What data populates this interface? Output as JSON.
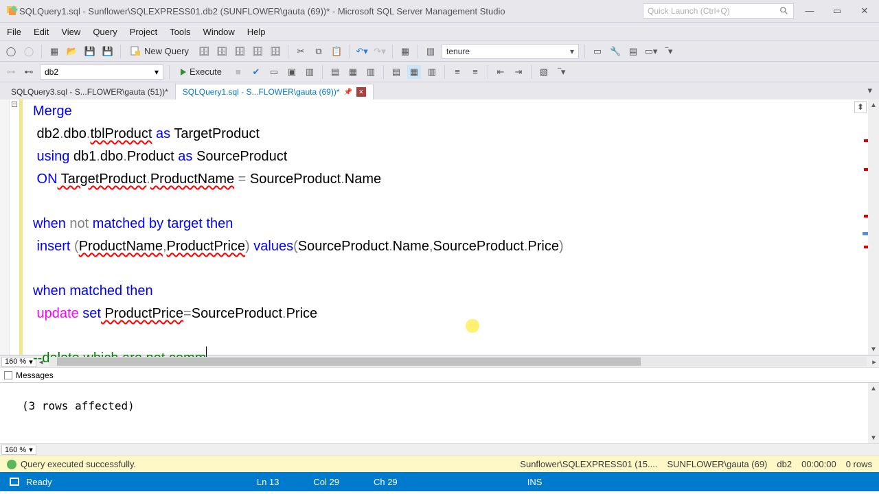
{
  "title": "SQLQuery1.sql - Sunflower\\SQLEXPRESS01.db2 (SUNFLOWER\\gauta (69))* - Microsoft SQL Server Management Studio",
  "quicklaunch": {
    "placeholder": "Quick Launch (Ctrl+Q)"
  },
  "menu": {
    "file": "File",
    "edit": "Edit",
    "view": "View",
    "query": "Query",
    "project": "Project",
    "tools": "Tools",
    "window": "Window",
    "help": "Help"
  },
  "toolbar": {
    "newquery": "New Query",
    "combo": "tenure"
  },
  "toolbar2": {
    "db": "db2",
    "execute": "Execute"
  },
  "tabs": {
    "t1": "SQLQuery3.sql - S...FLOWER\\gauta (51))*",
    "t2": "SQLQuery1.sql - S...FLOWER\\gauta (69))*"
  },
  "code": {
    "l1a": "Merge",
    "l2a": " db2",
    "l2b": ".",
    "l2c": "dbo",
    "l2d": ".",
    "l2e": "tblProduct",
    "l2f": " as",
    "l2g": " TargetProduct",
    "l3a": " using",
    "l3b": " db1",
    "l3c": ".",
    "l3d": "dbo",
    "l3e": ".",
    "l3f": "Product",
    "l3g": " as",
    "l3h": " SourceProduct",
    "l4a": " ON",
    "l4b": " TargetProduct",
    "l4c": ".",
    "l4d": "ProductName",
    "l4e": " =",
    "l4f": " SourceProduct",
    "l4g": ".",
    "l4h": "Name",
    "l6a": "when",
    "l6b": " not",
    "l6c": " matched",
    "l6d": " by",
    "l6e": " target",
    "l6f": " then",
    "l7a": " insert",
    "l7b": " (",
    "l7c": "ProductName",
    "l7d": ",",
    "l7e": "ProductPrice",
    "l7f": ")",
    "l7g": " values",
    "l7h": "(",
    "l7i": "SourceProduct",
    "l7j": ".",
    "l7k": "Name",
    "l7l": ",",
    "l7m": "SourceProduct",
    "l7n": ".",
    "l7o": "Price",
    "l7p": ")",
    "l9a": "when",
    "l9b": " matched",
    "l9c": " then",
    "l10a": " update",
    "l10b": " set",
    "l10c": " ProductPrice",
    "l10d": "=",
    "l10e": "SourceProduct",
    "l10f": ".",
    "l10g": "Price",
    "l12a": "--delete which are not comm"
  },
  "zoom": {
    "val": "160 %"
  },
  "messages": {
    "tab": "Messages",
    "body": "(3 rows affected)"
  },
  "status1": {
    "ok": "Query executed successfully.",
    "server": "Sunflower\\SQLEXPRESS01 (15....",
    "user": "SUNFLOWER\\gauta (69)",
    "db": "db2",
    "time": "00:00:00",
    "rows": "0 rows"
  },
  "status2": {
    "ready": "Ready",
    "ln": "Ln 13",
    "col": "Col 29",
    "ch": "Ch 29",
    "ins": "INS"
  }
}
